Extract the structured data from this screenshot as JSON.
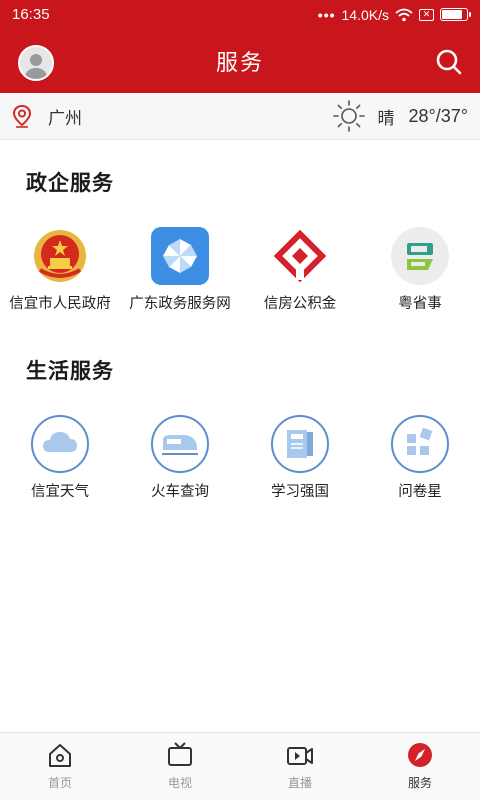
{
  "status_bar": {
    "time": "16:35",
    "network_speed": "14.0K/s",
    "battery_level": 0.85
  },
  "header": {
    "title": "服务"
  },
  "location_bar": {
    "city": "广州",
    "weather": "晴",
    "temperature": "28°/37°"
  },
  "gov_section": {
    "title": "政企服务",
    "items": [
      {
        "label": "信宜市人民政府",
        "icon": "national-emblem-icon"
      },
      {
        "label": "广东政务服务网",
        "icon": "pinwheel-icon"
      },
      {
        "label": "信房公积金",
        "icon": "housing-fund-icon"
      },
      {
        "label": "粤省事",
        "icon": "yue-app-icon"
      }
    ]
  },
  "life_section": {
    "title": "生活服务",
    "items": [
      {
        "label": "信宜天气",
        "icon": "cloud-icon"
      },
      {
        "label": "火车查询",
        "icon": "train-icon"
      },
      {
        "label": "学习强国",
        "icon": "book-icon"
      },
      {
        "label": "问卷星",
        "icon": "grid-squares-icon"
      }
    ]
  },
  "tabbar": {
    "tabs": [
      {
        "label": "首页",
        "icon": "home-icon"
      },
      {
        "label": "电视",
        "icon": "tv-icon"
      },
      {
        "label": "直播",
        "icon": "live-camera-icon"
      },
      {
        "label": "服务",
        "icon": "compass-icon"
      }
    ],
    "active_tab": "服务"
  },
  "colors": {
    "brand_red": "#c9161c",
    "life_icon_blue": "#5b8fd1"
  }
}
